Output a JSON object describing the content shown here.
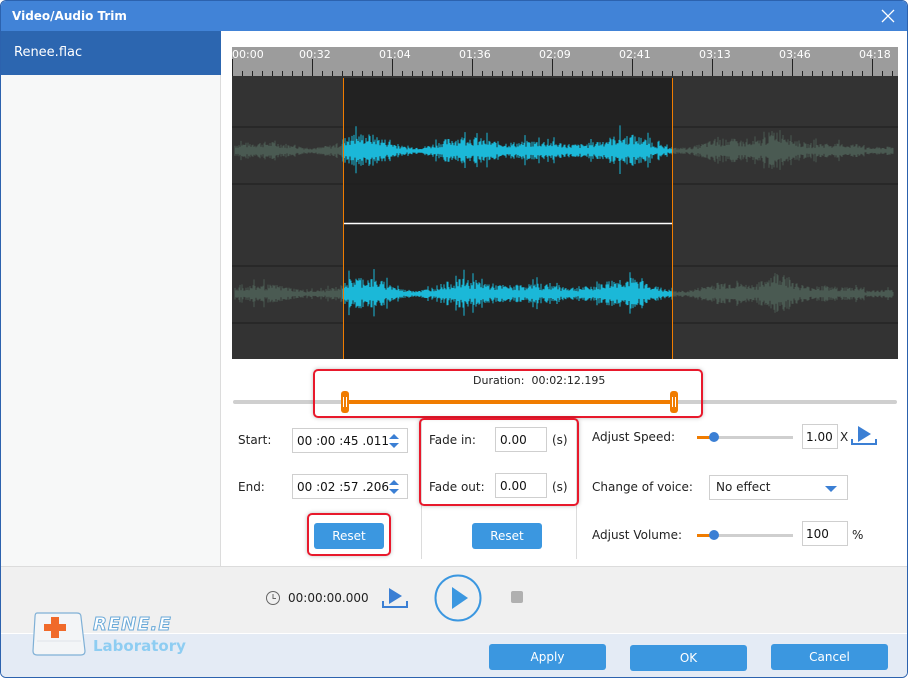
{
  "window": {
    "title": "Video/Audio Trim",
    "close_icon": "close-icon"
  },
  "sidebar": {
    "files": [
      {
        "name": "Renee.flac",
        "selected": true
      }
    ]
  },
  "timeline": {
    "ruler_labels": [
      "00:00",
      "00:32",
      "01:04",
      "01:36",
      "02:09",
      "02:41",
      "03:13",
      "03:46",
      "04:18"
    ],
    "selection_start_fraction": 0.167,
    "selection_end_fraction": 0.66,
    "duration_label": "Duration:",
    "duration_value": "00:02:12.195"
  },
  "trim": {
    "start_label": "Start:",
    "start_value": "00 :00 :45 .011",
    "end_label": "End:",
    "end_value": "00 :02 :57 .206",
    "reset_label": "Reset"
  },
  "fade": {
    "fade_in_label": "Fade in:",
    "fade_in_value": "0.00",
    "fade_out_label": "Fade out:",
    "fade_out_value": "0.00",
    "unit": "(s)",
    "reset_label": "Reset"
  },
  "effects": {
    "speed_label": "Adjust Speed:",
    "speed_value": "1.00",
    "speed_unit": "X",
    "speed_slider_fraction": 0.25,
    "voice_label": "Change of voice:",
    "voice_selected": "No effect",
    "volume_label": "Adjust Volume:",
    "volume_value": "100",
    "volume_unit": "%",
    "volume_slider_fraction": 0.25
  },
  "playback": {
    "time": "00:00:00.000",
    "clock_icon": "clock-icon",
    "play_selection_icon": "play-selection-icon",
    "play_icon": "play-icon",
    "stop_icon": "stop-icon"
  },
  "logo": {
    "brand": "RENE.E",
    "sub": "Laboratory"
  },
  "footer": {
    "apply_label": "Apply",
    "ok_label": "OK",
    "cancel_label": "Cancel"
  },
  "colors": {
    "accent": "#4183d7",
    "button": "#3b97e0",
    "selection_handle": "#f07c00",
    "highlight_box": "#e8192c",
    "waveform_selected": "#1bb8d8",
    "waveform_unselected": "#4a5a52"
  }
}
